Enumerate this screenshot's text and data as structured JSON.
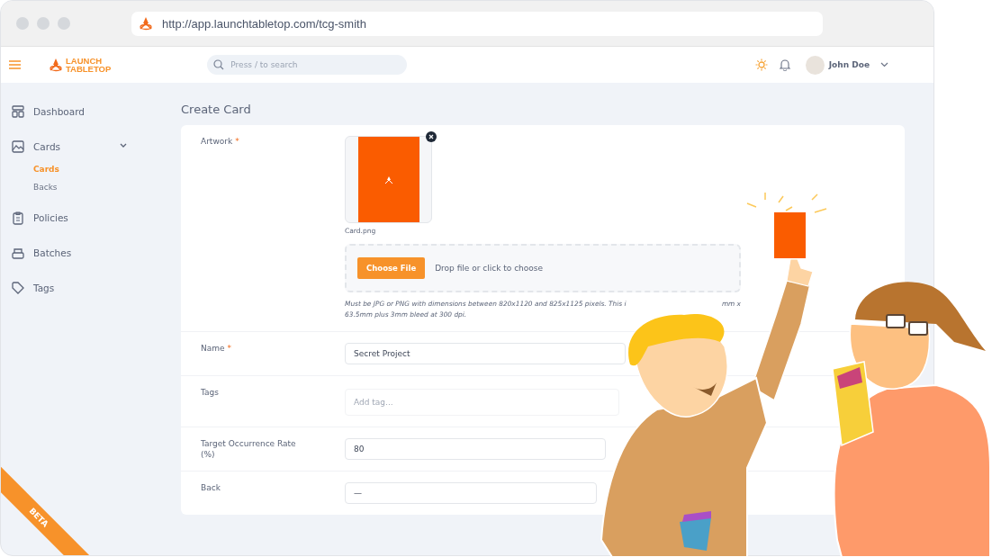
{
  "browser": {
    "url": "http://app.launchtabletop.com/tcg-smith"
  },
  "header": {
    "logo_lines": [
      "LAUNCH",
      "TABLETOP"
    ],
    "search": {
      "placeholder": "Press / to search"
    },
    "user": {
      "name": "John Doe"
    }
  },
  "sidebar": {
    "items": [
      {
        "kind": "link",
        "label": "Dashboard"
      },
      {
        "kind": "group",
        "label": "Cards",
        "expanded": true,
        "children": [
          {
            "label": "Cards",
            "selected": true
          },
          {
            "label": "Backs",
            "selected": false
          }
        ]
      },
      {
        "kind": "link",
        "label": "Policies"
      },
      {
        "kind": "link",
        "label": "Batches"
      },
      {
        "kind": "link",
        "label": "Tags"
      }
    ]
  },
  "page_title": "Create Card",
  "form": {
    "fields": [
      {
        "kind": "upload",
        "label": "Artwork",
        "required_mark": "*",
        "file_name": "Card.png",
        "button": "Choose File",
        "drop_text": "Drop file or click to choose",
        "hint_parts": [
          "Must be JPG or PNG with dimensions between 820x1120 and 825x1125 pixels. This i",
          "mm x",
          "63.5mm plus 3mm bleed at 300 dpi."
        ]
      },
      {
        "kind": "text",
        "label": "Name",
        "required_mark": "*",
        "value": "Secret Project"
      },
      {
        "kind": "tags",
        "label": "Tags",
        "placeholder": "Add tag..."
      },
      {
        "kind": "text",
        "label": "Target Occurrence Rate (%)",
        "value": "80"
      },
      {
        "kind": "select",
        "label": "Back",
        "value": "—"
      }
    ]
  },
  "beta_ribbon": "BETA"
}
